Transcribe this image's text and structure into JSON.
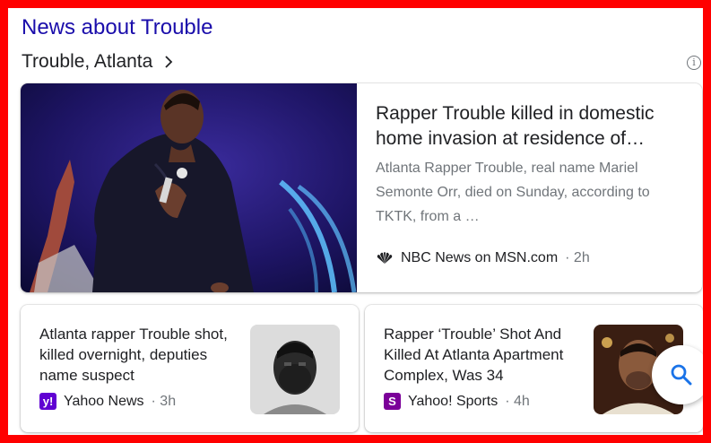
{
  "heading": "News about Trouble",
  "subheading": "Trouble, Atlanta",
  "info_icon": "info-icon",
  "main_story": {
    "title": "Rapper Trouble killed in domestic home invasion at residence of…",
    "snippet": "Atlanta Rapper Trouble, real name Mariel Semonte Orr, died on Sunday, according to TKTK, from a …",
    "source": "NBC News on MSN.com",
    "time": "· 2h",
    "source_icon": "nbc-peacock-icon"
  },
  "stories": [
    {
      "title": "Atlanta rapper Trouble shot, killed overnight, deputies name suspect",
      "source": "Yahoo News",
      "time": "· 3h",
      "logo_letter": "y!",
      "logo_color": "#6001d2"
    },
    {
      "title": "Rapper ‘Trouble’ Shot And Killed At Atlanta Apartment Complex, Was 34",
      "source": "Yahoo! Sports",
      "time": "· 4h",
      "logo_letter": "S",
      "logo_color": "#7b0099"
    }
  ],
  "colors": {
    "border": "#ff0000",
    "link": "#1a0dab",
    "search_icon": "#1a73e8"
  }
}
